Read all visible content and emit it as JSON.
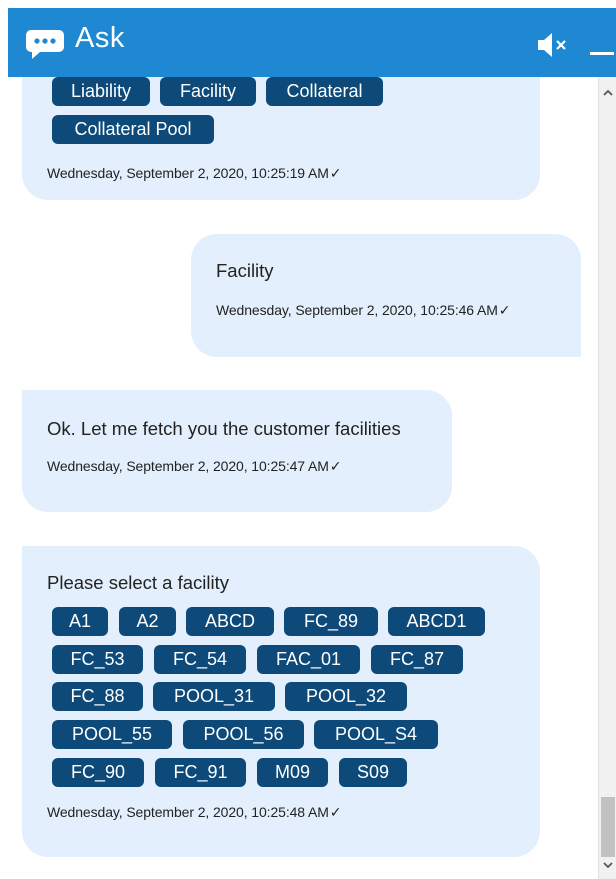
{
  "header": {
    "title": "Ask",
    "chat_icon": "chat-bubble-icon",
    "mute_icon": "speaker-mute-icon",
    "minimize_icon": "minimize-icon"
  },
  "colors": {
    "header_bg": "#1e88d2",
    "bubble_bg": "#e3effc",
    "chip_bg": "#0d4a7a"
  },
  "messages": [
    {
      "sender": "bot",
      "options": [
        "Liability",
        "Facility",
        "Collateral",
        "Collateral Pool"
      ],
      "timestamp": "Wednesday, September 2, 2020, 10:25:19 AM",
      "check": "✓"
    },
    {
      "sender": "user",
      "text": "Facility",
      "timestamp": "Wednesday, September 2, 2020, 10:25:46 AM",
      "check": "✓"
    },
    {
      "sender": "bot",
      "text": "Ok. Let me fetch you the customer facilities",
      "timestamp": "Wednesday, September 2, 2020, 10:25:47 AM",
      "check": "✓"
    },
    {
      "sender": "bot",
      "text": "Please select a facility",
      "options": [
        "A1",
        "A2",
        "ABCD",
        "FC_89",
        "ABCD1",
        "FC_53",
        "FC_54",
        "FAC_01",
        "FC_87",
        "FC_88",
        "POOL_31",
        "POOL_32",
        "POOL_55",
        "POOL_56",
        "POOL_S4",
        "FC_90",
        "FC_91",
        "M09",
        "S09"
      ],
      "timestamp": "Wednesday, September 2, 2020, 10:25:48 AM",
      "check": "✓"
    }
  ]
}
